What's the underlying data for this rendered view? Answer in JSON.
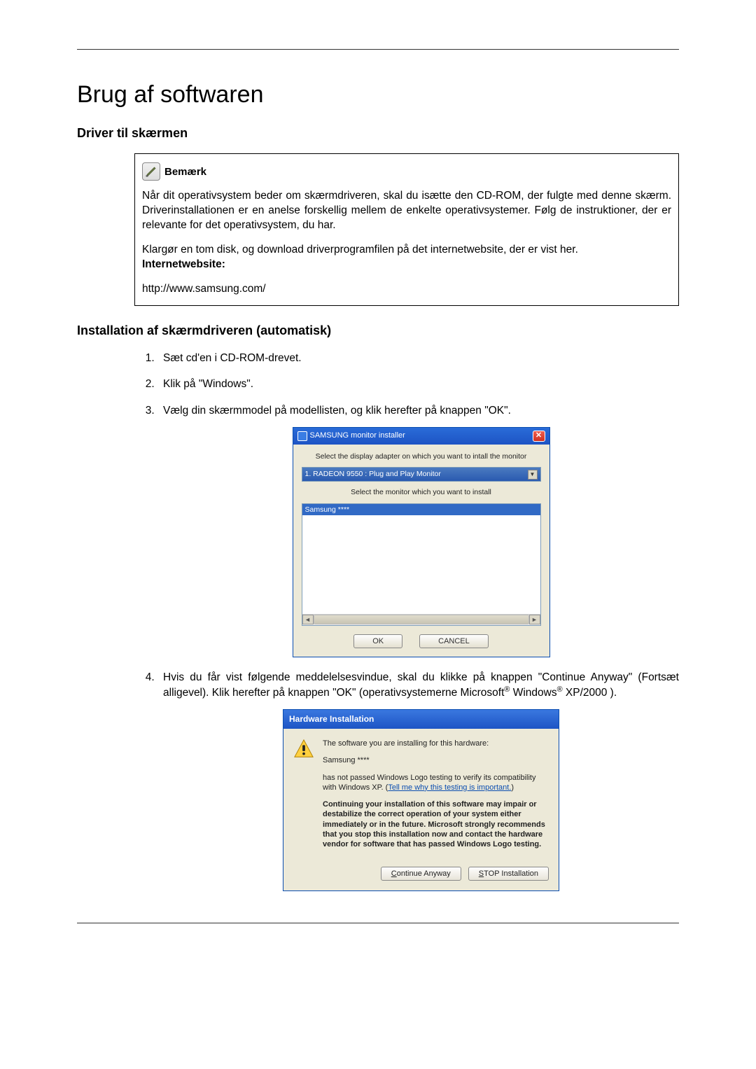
{
  "page": {
    "title": "Brug af softwaren",
    "section1": "Driver til skærmen",
    "note_label": "Bemærk",
    "note_p1": "Når dit operativsystem beder om skærmdriveren, skal du isætte den CD-ROM, der fulgte med denne skærm. Driverinstallationen er en anelse forskellig mellem de enkelte operativsystemer. Følg de instruktioner, der er relevante for det operativsystem, du har.",
    "note_p2": "Klargør en tom disk, og download driverprogramfilen på det internetwebsite, der er vist her.",
    "note_inet_label": "Internetwebsite:",
    "note_url": "http://www.samsung.com/",
    "section2": "Installation af skærmdriveren (automatisk)",
    "li1": "Sæt cd'en i CD-ROM-drevet.",
    "li2": "Klik på \"Windows\".",
    "li3": "Vælg din skærmmodel på modellisten, og klik herefter på knappen \"OK\".",
    "li4_a": "Hvis du får vist følgende meddelelsesvindue, skal du klikke på knappen \"Continue Anyway\" (Fortsæt alligevel). Klik herefter på knappen \"OK\" (operativsystemerne Microsoft",
    "li4_b": " Windows",
    "li4_c": " XP/2000 )."
  },
  "dialog1": {
    "title": "SAMSUNG monitor installer",
    "label1": "Select the display adapter on which you want to intall the monitor",
    "select_value": "1. RADEON 9550 : Plug and Play Monitor",
    "label2": "Select the monitor which you want to install",
    "list_item": "Samsung ****",
    "ok": "OK",
    "cancel": "CANCEL"
  },
  "dialog2": {
    "title": "Hardware Installation",
    "p1": "The software you are installing for this hardware:",
    "p2": "Samsung ****",
    "p3a": "has not passed Windows Logo testing to verify its compatibility with Windows XP. (",
    "p3link": "Tell me why this testing is important.",
    "p3b": ")",
    "p4": "Continuing your installation of this software may impair or destabilize the correct operation of your system either immediately or in the future. Microsoft strongly recommends that you stop this installation now and contact the hardware vendor for software that has passed Windows Logo testing.",
    "btn_continue": "Continue Anyway",
    "btn_continue_underline": "C",
    "btn_stop": "STOP Installation",
    "btn_stop_underline": "S"
  }
}
